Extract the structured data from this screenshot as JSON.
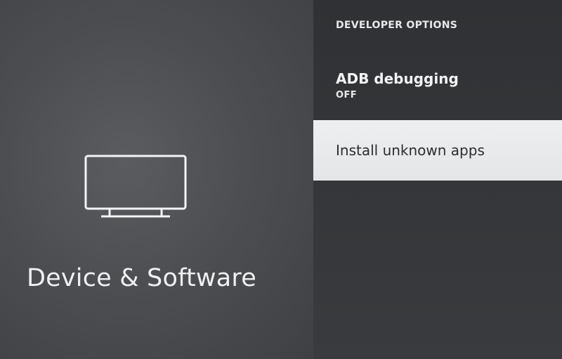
{
  "category": {
    "title": "Device & Software",
    "icon": "tv-icon"
  },
  "developer_options": {
    "header": "DEVELOPER OPTIONS",
    "items": [
      {
        "label": "ADB debugging",
        "value": "OFF",
        "selected": false
      },
      {
        "label": "Install unknown apps",
        "selected": true
      }
    ]
  },
  "colors": {
    "selected_background": "#e6e8ea",
    "text": "#eef0f2",
    "selected_text": "#2b2d30"
  }
}
